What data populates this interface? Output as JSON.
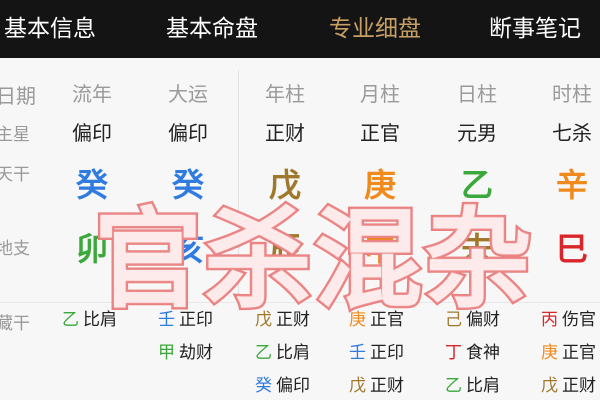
{
  "nav": {
    "tabs": [
      {
        "label": "基本信息"
      },
      {
        "label": "基本命盘"
      },
      {
        "label": "专业细盘"
      },
      {
        "label": "断事笔记"
      }
    ],
    "active_color": "#c8a064"
  },
  "row_labels": {
    "date": "日期",
    "main_star": "主星",
    "tian_gan": "天干",
    "di_zhi": "地支",
    "cang_gan": "藏干"
  },
  "columns": [
    {
      "header": "流年",
      "main": "偏印",
      "gan": {
        "text": "癸",
        "color": "#2f7be0"
      },
      "zhi": {
        "text": "卯",
        "color": "#3aa83a"
      },
      "hidden": [
        {
          "g": "乙",
          "gc": "#3aa83a",
          "r": "比肩"
        }
      ]
    },
    {
      "header": "大运",
      "main": "偏印",
      "gan": {
        "text": "癸",
        "color": "#2f7be0"
      },
      "zhi": {
        "text": "亥",
        "color": "#2f7be0"
      },
      "hidden": [
        {
          "g": "壬",
          "gc": "#2f7be0",
          "r": "正印"
        },
        {
          "g": "甲",
          "gc": "#3aa83a",
          "r": "劫财"
        }
      ]
    },
    {
      "header": "年柱",
      "main": "正财",
      "gan": {
        "text": "戊",
        "color": "#a0782c"
      },
      "zhi": {
        "text": "辰",
        "color": "#a0782c"
      },
      "hidden": [
        {
          "g": "戊",
          "gc": "#a0782c",
          "r": "正财"
        },
        {
          "g": "乙",
          "gc": "#3aa83a",
          "r": "比肩"
        },
        {
          "g": "癸",
          "gc": "#2f7be0",
          "r": "偏印"
        }
      ]
    },
    {
      "header": "月柱",
      "main": "正官",
      "gan": {
        "text": "庚",
        "color": "#f08a1c"
      },
      "zhi": {
        "text": "申",
        "color": "#f08a1c"
      },
      "hidden": [
        {
          "g": "庚",
          "gc": "#f08a1c",
          "r": "正官"
        },
        {
          "g": "壬",
          "gc": "#2f7be0",
          "r": "正印"
        },
        {
          "g": "戊",
          "gc": "#a0782c",
          "r": "正财"
        }
      ]
    },
    {
      "header": "日柱",
      "main": "元男",
      "gan": {
        "text": "乙",
        "color": "#3aa83a"
      },
      "zhi": {
        "text": "未",
        "color": "#a0782c"
      },
      "hidden": [
        {
          "g": "己",
          "gc": "#a0782c",
          "r": "偏财"
        },
        {
          "g": "丁",
          "gc": "#d8262a",
          "r": "食神"
        },
        {
          "g": "乙",
          "gc": "#3aa83a",
          "r": "比肩"
        }
      ]
    },
    {
      "header": "时柱",
      "main": "七杀",
      "gan": {
        "text": "辛",
        "color": "#f08a1c"
      },
      "zhi": {
        "text": "巳",
        "color": "#d8262a"
      },
      "hidden": [
        {
          "g": "丙",
          "gc": "#d8262a",
          "r": "伤官"
        },
        {
          "g": "庚",
          "gc": "#f08a1c",
          "r": "正官"
        },
        {
          "g": "戊",
          "gc": "#a0782c",
          "r": "正财"
        }
      ]
    }
  ],
  "overlay": {
    "text": "官杀混杂"
  }
}
